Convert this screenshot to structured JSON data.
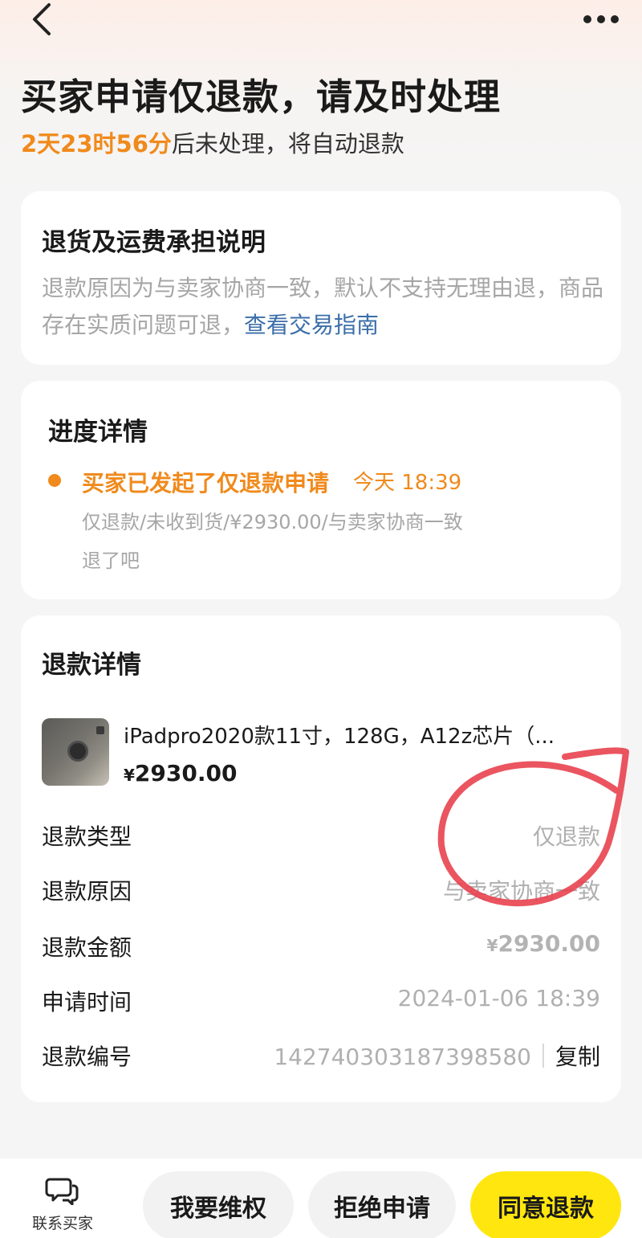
{
  "header": {
    "title": "买家申请仅退款，请及时处理",
    "countdown": "2天23时56分",
    "countdown_suffix": "后未处理，将自动退款"
  },
  "policy_card": {
    "title": "退货及运费承担说明",
    "text": "退款原因为与卖家协商一致，默认不支持无理由退，商品存在实质问题可退，",
    "link": "查看交易指南"
  },
  "progress_card": {
    "title": "进度详情",
    "status": "买家已发起了仅退款申请",
    "time": "今天 18:39",
    "detail": "仅退款/未收到货/¥2930.00/与卖家协商一致",
    "note": "退了吧"
  },
  "refund_card": {
    "title": "退款详情",
    "product": {
      "title": "iPadpro2020款11寸，128G，A12z芯片（...",
      "currency": "¥",
      "price": "2930.00"
    },
    "rows": [
      {
        "label": "退款类型",
        "value": "仅退款"
      },
      {
        "label": "退款原因",
        "value": "与卖家协商一致"
      },
      {
        "label": "退款金额",
        "currency": "¥",
        "value": "2930.00"
      },
      {
        "label": "申请时间",
        "value": "2024-01-06 18:39"
      },
      {
        "label": "退款编号",
        "value": "1427403031873985​80",
        "copy": "复制"
      }
    ]
  },
  "bottom_bar": {
    "contact": "联系买家",
    "buttons": [
      "我要维权",
      "拒绝申请",
      "同意退款"
    ]
  },
  "colors": {
    "accent_orange": "#f08a1c",
    "link_blue": "#3b6ea8",
    "primary_yellow": "#ffe60f",
    "annotation_red": "#e8434f"
  },
  "icons": [
    "back-arrow-icon",
    "more-dots-icon",
    "chat-bubble-icon"
  ]
}
